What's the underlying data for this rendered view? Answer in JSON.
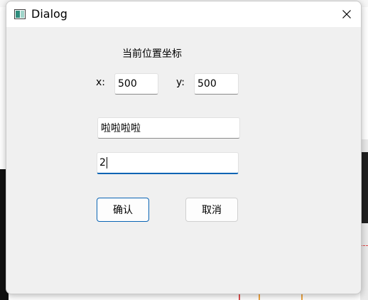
{
  "window": {
    "title": "Dialog"
  },
  "form": {
    "heading": "当前位置坐标",
    "x_label": "x:",
    "x_value": "500",
    "y_label": "y:",
    "y_value": "500",
    "name_value": "啦啦啦啦",
    "number_value": "2"
  },
  "buttons": {
    "confirm": "确认",
    "cancel": "取消"
  },
  "icons": {
    "app": "window-app-icon",
    "close": "close-icon"
  },
  "colors": {
    "accent": "#0a64b4",
    "dialog_bg": "#f0f0f0",
    "titlebar_bg": "#ffffff"
  }
}
